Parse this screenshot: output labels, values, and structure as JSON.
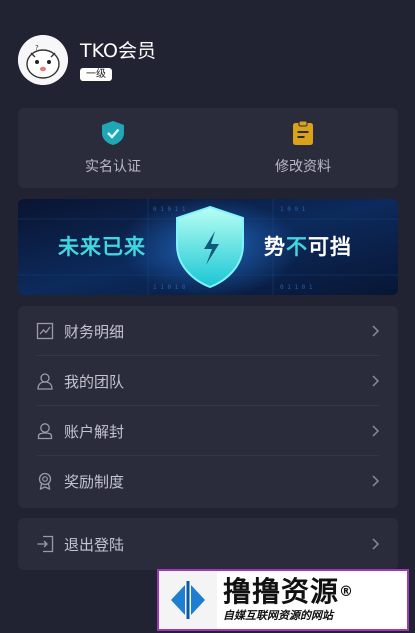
{
  "profile": {
    "username": "TKO会员",
    "level": "一级"
  },
  "actions": [
    {
      "label": "实名认证",
      "icon": "shield-check-icon",
      "color": "#1fa7b5"
    },
    {
      "label": "修改资料",
      "icon": "clipboard-icon",
      "color": "#d9a219"
    }
  ],
  "banner": {
    "left_text": "未来已来",
    "right_text_a": "势",
    "right_text_b": "不",
    "right_text_c": "可挡"
  },
  "menu": [
    {
      "label": "财务明细",
      "icon": "chart-icon"
    },
    {
      "label": "我的团队",
      "icon": "team-icon"
    },
    {
      "label": "账户解封",
      "icon": "user-unlock-icon"
    },
    {
      "label": "奖励制度",
      "icon": "medal-icon"
    }
  ],
  "logout": {
    "label": "退出登陆",
    "icon": "logout-icon"
  },
  "watermark": {
    "title": "撸撸资源",
    "reg": "®",
    "subtitle": "自媒互联网资源的网站"
  }
}
